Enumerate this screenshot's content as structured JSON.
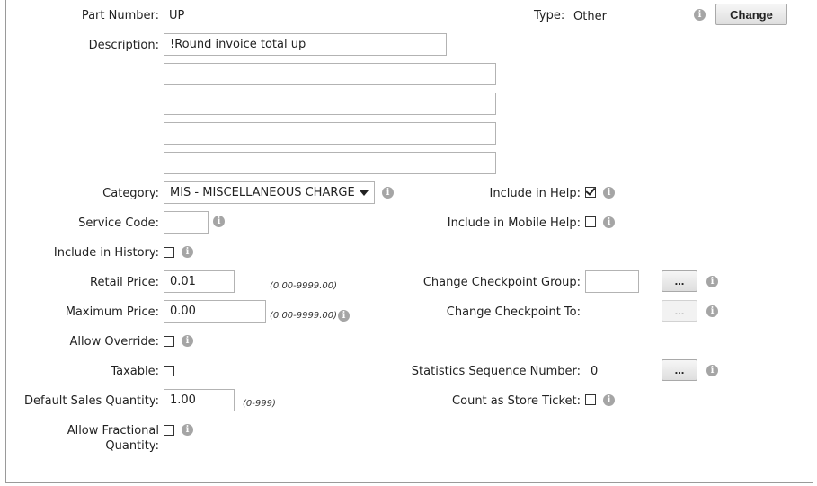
{
  "header": {
    "part_number_label": "Part Number:",
    "part_number_value": "UP",
    "type_label": "Type:",
    "type_value": "Other",
    "change_button": "Change"
  },
  "description": {
    "label": "Description:",
    "lines": [
      "!Round invoice total up",
      "",
      "",
      "",
      ""
    ]
  },
  "category": {
    "label": "Category:",
    "selected": "MIS - MISCELLANEOUS CHARGE"
  },
  "service_code": {
    "label": "Service Code:",
    "value": ""
  },
  "include_in_history": {
    "label": "Include in History:",
    "checked": false
  },
  "retail_price": {
    "label": "Retail Price:",
    "value": "0.01",
    "range": "(0.00-9999.00)"
  },
  "maximum_price": {
    "label": "Maximum Price:",
    "value": "0.00",
    "range": "(0.00-9999.00)"
  },
  "allow_override": {
    "label": "Allow Override:",
    "checked": false
  },
  "taxable": {
    "label": "Taxable:",
    "checked": false
  },
  "default_sales_quantity": {
    "label": "Default Sales Quantity:",
    "value": "1.00",
    "range": "(0-999)"
  },
  "allow_fractional_quantity": {
    "label_line1": "Allow Fractional",
    "label_line2": "Quantity:",
    "checked": false
  },
  "include_in_help": {
    "label": "Include in Help:",
    "checked": true
  },
  "include_in_mobile_help": {
    "label": "Include in Mobile Help:",
    "checked": false
  },
  "change_checkpoint_group": {
    "label": "Change Checkpoint Group:",
    "value": "",
    "button": "..."
  },
  "change_checkpoint_to": {
    "label": "Change Checkpoint To:",
    "button": "..."
  },
  "statistics_sequence_number": {
    "label": "Statistics Sequence Number:",
    "value": "0",
    "button": "..."
  },
  "count_as_store_ticket": {
    "label": "Count as Store Ticket:",
    "checked": false
  },
  "icons": {
    "info": "info-icon",
    "checkbox": "checkbox",
    "dropdown": "chevron-down-icon"
  },
  "colors": {
    "info_icon": "#a5a5a5",
    "border": "#b3b3b3",
    "frame": "#9a9a9a"
  }
}
